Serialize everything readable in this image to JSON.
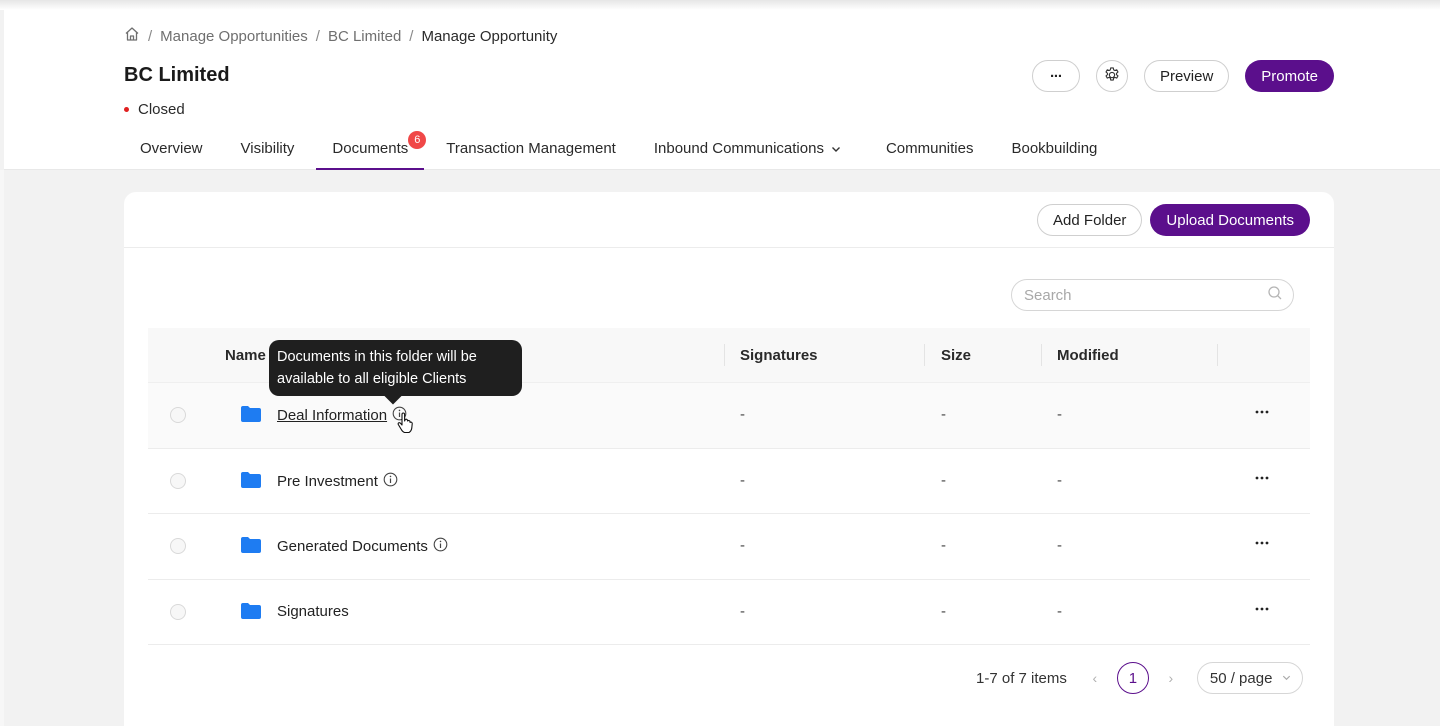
{
  "breadcrumb": {
    "items": [
      "Manage Opportunities",
      "BC Limited",
      "Manage Opportunity"
    ],
    "separator": "/"
  },
  "page": {
    "title": "BC Limited",
    "status": "Closed",
    "status_color": "#e02020"
  },
  "actions": {
    "more_label": "···",
    "preview_label": "Preview",
    "promote_label": "Promote"
  },
  "tabs": [
    {
      "label": "Overview"
    },
    {
      "label": "Visibility"
    },
    {
      "label": "Documents",
      "badge": "6",
      "active": true
    },
    {
      "label": "Transaction Management"
    },
    {
      "label": "Inbound Communications",
      "has_dropdown": true
    },
    {
      "label": "Communities"
    },
    {
      "label": "Bookbuilding"
    }
  ],
  "toolbar": {
    "add_folder_label": "Add Folder",
    "upload_label": "Upload Documents"
  },
  "search": {
    "placeholder": "Search",
    "value": ""
  },
  "table": {
    "columns": [
      "Name",
      "Signatures",
      "Size",
      "Modified"
    ],
    "rows": [
      {
        "name": "Deal Information",
        "signatures": "-",
        "size": "-",
        "modified": "-",
        "info": true
      },
      {
        "name": "Pre Investment",
        "signatures": "-",
        "size": "-",
        "modified": "-",
        "info": true
      },
      {
        "name": "Generated Documents",
        "signatures": "-",
        "size": "-",
        "modified": "-",
        "info": true
      },
      {
        "name": "Signatures",
        "signatures": "-",
        "size": "-",
        "modified": "-",
        "info": false
      }
    ]
  },
  "tooltip": {
    "text": "Documents in this folder will be available to all eligible Clients"
  },
  "pagination": {
    "summary": "1-7 of 7 items",
    "current_page": "1",
    "page_size": "50 / page"
  },
  "colors": {
    "brand": "#5b0f8c",
    "badge": "#f04848",
    "folder": "#1e7cf2"
  }
}
